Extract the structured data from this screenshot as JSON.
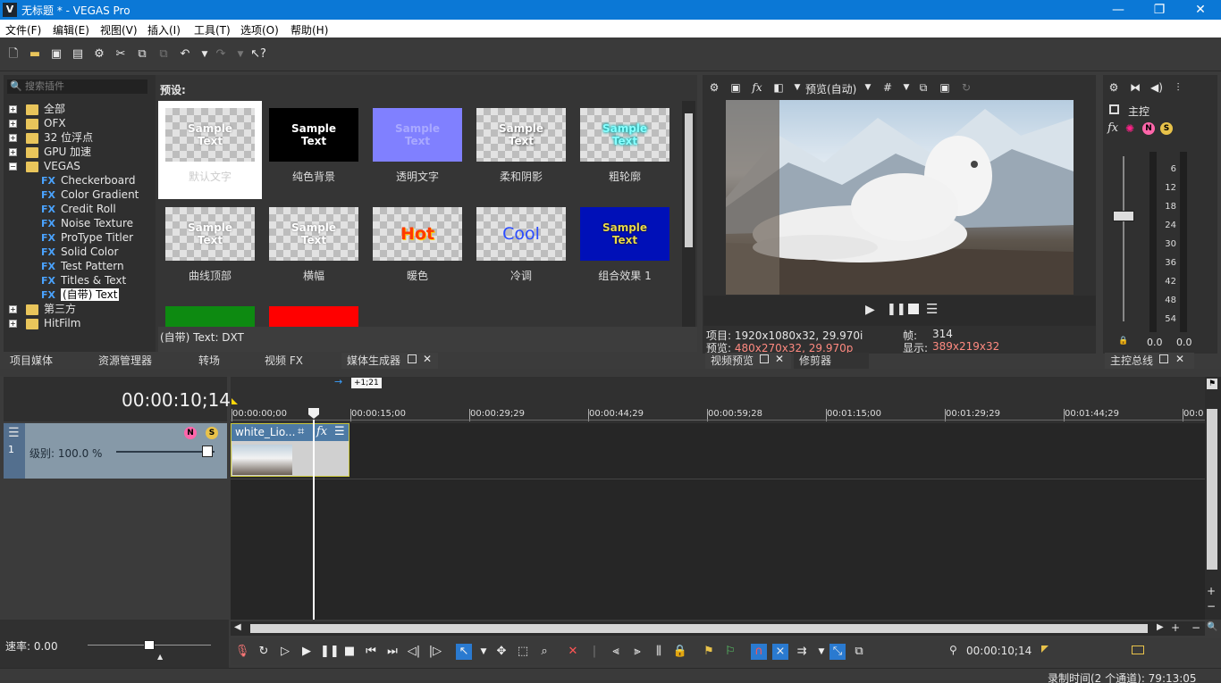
{
  "window": {
    "title": "无标题 * - VEGAS Pro",
    "logo_letter": "V",
    "minimize": "—",
    "maximize": "❐",
    "close": "✕"
  },
  "menu": [
    "文件(F)",
    "编辑(E)",
    "视图(V)",
    "插入(I)",
    "工具(T)",
    "选项(O)",
    "帮助(H)"
  ],
  "plugins": {
    "search_placeholder": "搜索插件",
    "items": [
      {
        "label": "全部",
        "type": "folder",
        "expander": "+"
      },
      {
        "label": "OFX",
        "type": "folder",
        "expander": "+"
      },
      {
        "label": "32 位浮点",
        "type": "folder",
        "expander": "+"
      },
      {
        "label": "GPU 加速",
        "type": "folder",
        "expander": "+"
      },
      {
        "label": "VEGAS",
        "type": "folder",
        "expander": "−"
      },
      {
        "label": "Checkerboard",
        "type": "fx"
      },
      {
        "label": "Color Gradient",
        "type": "fx"
      },
      {
        "label": "Credit Roll",
        "type": "fx"
      },
      {
        "label": "Noise Texture",
        "type": "fx"
      },
      {
        "label": "ProType Titler",
        "type": "fx"
      },
      {
        "label": "Solid Color",
        "type": "fx"
      },
      {
        "label": "Test Pattern",
        "type": "fx"
      },
      {
        "label": "Titles & Text",
        "type": "fx"
      },
      {
        "label": "(自带) Text",
        "type": "fx",
        "selected": true
      },
      {
        "label": "第三方",
        "type": "folder",
        "expander": "+"
      },
      {
        "label": "HitFilm",
        "type": "folder",
        "expander": "+"
      }
    ],
    "fx_badge": "FX"
  },
  "presets": {
    "heading": "预设:",
    "items": [
      {
        "label": "默认文字",
        "sample": "Sample\nText"
      },
      {
        "label": "纯色背景",
        "sample": "Sample\nText"
      },
      {
        "label": "透明文字",
        "sample": "Sample\nText"
      },
      {
        "label": "柔和阴影",
        "sample": "Sample\nText"
      },
      {
        "label": "粗轮廓",
        "sample": "Sample\nText"
      },
      {
        "label": "曲线顶部",
        "sample": "Sample\nText"
      },
      {
        "label": "横幅",
        "sample": "Sample\nText"
      },
      {
        "label": "暖色",
        "sample": "Hot"
      },
      {
        "label": "冷调",
        "sample": "Cool"
      },
      {
        "label": "组合效果 1",
        "sample": "Sample\nText"
      }
    ],
    "status": "(自带) Text: DXT"
  },
  "left_tabs": [
    "项目媒体",
    "资源管理器",
    "转场",
    "视频 FX",
    "媒体生成器"
  ],
  "preview": {
    "mode": "预览(自动)",
    "info_project_label": "项目:",
    "info_project": "1920x1080x32, 29.970i",
    "info_preview_label": "预览:",
    "info_preview": "480x270x32, 29.970p",
    "info_frame_label": "帧:",
    "info_frame": "314",
    "info_display_label": "显示:",
    "info_display": "389x219x32",
    "tabs": [
      "视频预览",
      "修剪器"
    ]
  },
  "master": {
    "label": "主控",
    "scale": [
      "6",
      "12",
      "18",
      "24",
      "30",
      "36",
      "42",
      "48",
      "54"
    ],
    "left_value": "0.0",
    "right_value": "0.0",
    "tab": "主控总线"
  },
  "timeline": {
    "timecode": "00:00:10;14",
    "offset": "+1;21",
    "ticks": [
      "00:00:00;00",
      "00:00:15;00",
      "00:00:29;29",
      "00:00:44;29",
      "00:00:59;28",
      "00:01:15;00",
      "00:01:29;29",
      "00:01:44;29",
      "00:0"
    ],
    "track_number": "1",
    "track_level": "级别: 100.0 %",
    "clip_name": "white_Lio..."
  },
  "rate": "速率: 0.00",
  "transport_timecode": "00:00:10;14",
  "status": "录制时间(2 个通道): 79:13:05",
  "colors": {
    "accent": "#0b78d6",
    "clip": "#c9c63a",
    "info_red": "#ff8a80"
  }
}
